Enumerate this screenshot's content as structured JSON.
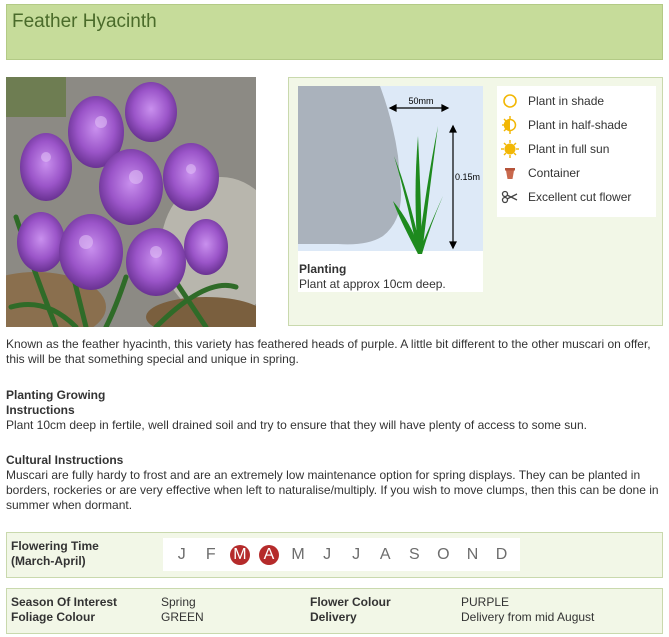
{
  "title": "Feather Hyacinth",
  "diagram": {
    "width_label": "50mm",
    "height_label": "0.15m"
  },
  "planting": {
    "label": "Planting",
    "text": "Plant at approx 10cm deep."
  },
  "legend": [
    {
      "icon": "shade-icon",
      "label": "Plant in shade"
    },
    {
      "icon": "half-shade-icon",
      "label": "Plant in half-shade"
    },
    {
      "icon": "full-sun-icon",
      "label": "Plant in full sun"
    },
    {
      "icon": "container-icon",
      "label": "Container"
    },
    {
      "icon": "scissors-icon",
      "label": "Excellent cut flower"
    }
  ],
  "description": "Known as the feather hyacinth, this variety has feathered heads of purple. A little bit different to the other muscari on offer, this will be that something special and unique in spring.",
  "planting_growing": {
    "heading": "Planting Growing Instructions",
    "text": "Plant 10cm deep in fertile, well drained soil and try to ensure that they will have plenty of access to some sun."
  },
  "cultural": {
    "heading": "Cultural Instructions",
    "text": "Muscari are fully hardy to frost and are an extremely low maintenance option for spring displays. They can be planted in borders, rockeries or are very effective when left to naturalise/multiply. If you wish to move clumps, then this can be done in summer when dormant."
  },
  "flowering": {
    "label": "Flowering Time",
    "period": "(March-April)",
    "months": [
      {
        "letter": "J",
        "active": false
      },
      {
        "letter": "F",
        "active": false
      },
      {
        "letter": "M",
        "active": true
      },
      {
        "letter": "A",
        "active": true
      },
      {
        "letter": "M",
        "active": false
      },
      {
        "letter": "J",
        "active": false
      },
      {
        "letter": "J",
        "active": false
      },
      {
        "letter": "A",
        "active": false
      },
      {
        "letter": "S",
        "active": false
      },
      {
        "letter": "O",
        "active": false
      },
      {
        "letter": "N",
        "active": false
      },
      {
        "letter": "D",
        "active": false
      }
    ]
  },
  "properties": {
    "season_label": "Season Of Interest",
    "season_value": "Spring",
    "foliage_label": "Foliage Colour",
    "foliage_value": "GREEN",
    "flower_colour_label": "Flower Colour",
    "flower_colour_value": "PURPLE",
    "delivery_label": "Delivery",
    "delivery_value": "Delivery from mid August"
  },
  "colors": {
    "header_bg": "#c6dc9a",
    "panel_bg": "#f2f7e7",
    "title_text": "#4a6b2a",
    "active_month": "#b52b2b",
    "flower_purple": "#9b55c9"
  }
}
